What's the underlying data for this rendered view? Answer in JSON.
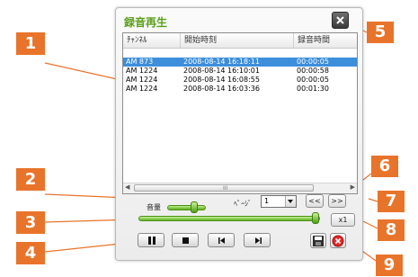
{
  "window": {
    "title": "録音再生",
    "close_icon": "close-icon"
  },
  "table": {
    "columns": [
      "ﾁｬﾝﾈﾙ",
      "開始時刻",
      "録音時間"
    ],
    "rows": [
      {
        "channel": "AM 873",
        "start": "2008-08-14 16:18:11",
        "duration": "00:00:05",
        "selected": true
      },
      {
        "channel": "AM 1224",
        "start": "2008-08-14 16:10:01",
        "duration": "00:00:58",
        "selected": false
      },
      {
        "channel": "AM 1224",
        "start": "2008-08-14 16:08:55",
        "duration": "00:00:05",
        "selected": false
      },
      {
        "channel": "AM 1224",
        "start": "2008-08-14 16:03:36",
        "duration": "00:01:30",
        "selected": false
      }
    ],
    "scrollbar_grip": "III"
  },
  "controls": {
    "volume_label": "音量",
    "volume_level": 0.75,
    "page_label": "ﾍﾟｰｼﾞ",
    "page_value": "1",
    "prev_label": "<<",
    "next_label": ">>",
    "speed_label": "x1",
    "seek_level": 1.0,
    "icons": [
      "pause-icon",
      "stop-icon",
      "skip-back-icon",
      "skip-forward-icon",
      "save-icon",
      "delete-icon"
    ]
  },
  "callouts": [
    "1",
    "2",
    "3",
    "4",
    "5",
    "6",
    "7",
    "8",
    "9"
  ],
  "colors": {
    "title_green": "#5aa01c",
    "selection_blue": "#3d8edb",
    "callout_orange": "#e8742b"
  }
}
